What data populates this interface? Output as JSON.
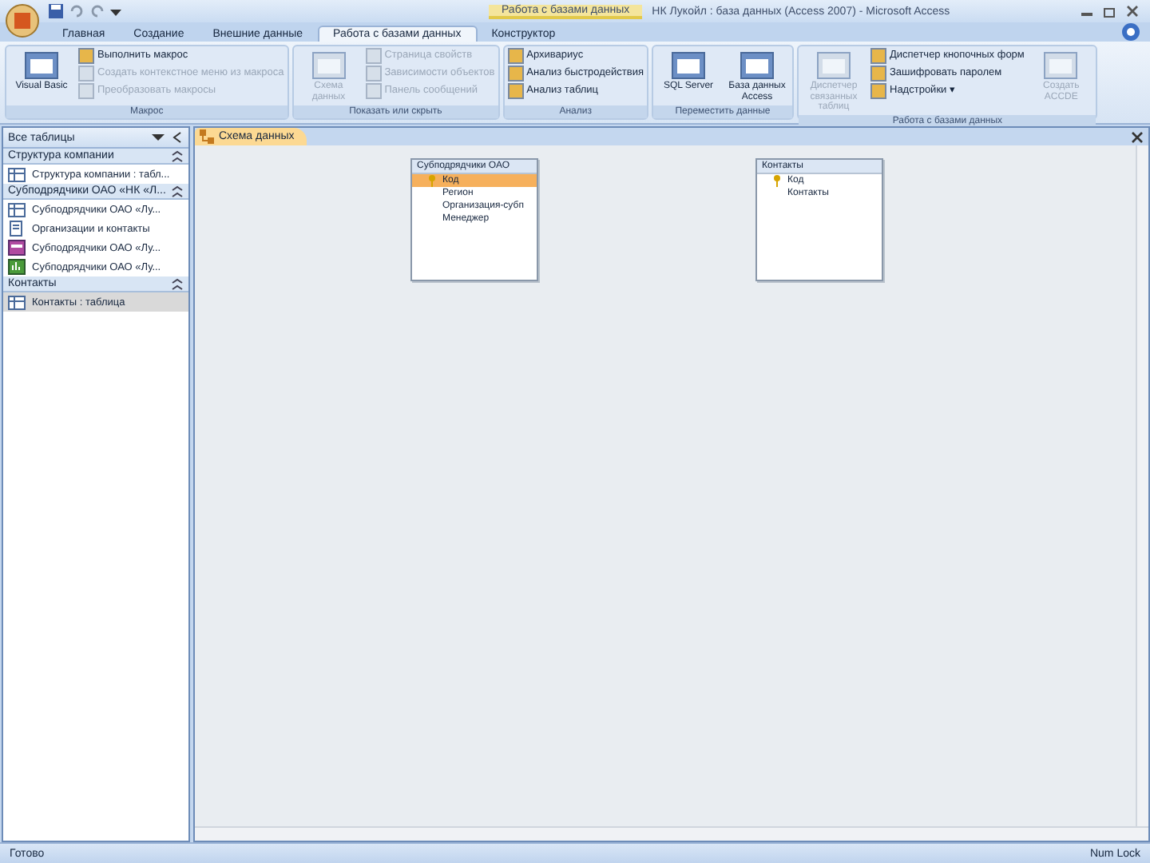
{
  "window": {
    "context_tab_title": "Работа с базами данных",
    "title": "НК Лукойл : база данных (Access 2007) - Microsoft Access"
  },
  "tabs": [
    {
      "label": "Главная",
      "selected": false
    },
    {
      "label": "Создание",
      "selected": false
    },
    {
      "label": "Внешние данные",
      "selected": false
    },
    {
      "label": "Работа с базами данных",
      "selected": true
    },
    {
      "label": "Конструктор",
      "selected": false
    }
  ],
  "ribbon_groups": [
    {
      "label": "Макрос",
      "large": [
        {
          "label": "Visual Basic",
          "disabled": false
        }
      ],
      "small": [
        {
          "label": "Выполнить макрос",
          "disabled": false
        },
        {
          "label": "Создать контекстное меню из макроса",
          "disabled": true
        },
        {
          "label": "Преобразовать макросы",
          "disabled": true
        }
      ]
    },
    {
      "label": "Показать или скрыть",
      "large": [
        {
          "label": "Схема данных",
          "disabled": true
        }
      ],
      "small": [
        {
          "label": "Страница свойств",
          "disabled": true
        },
        {
          "label": "Зависимости объектов",
          "disabled": true
        },
        {
          "label": "Панель сообщений",
          "disabled": true
        }
      ]
    },
    {
      "label": "Анализ",
      "small": [
        {
          "label": "Архивариус",
          "disabled": false
        },
        {
          "label": "Анализ быстродействия",
          "disabled": false
        },
        {
          "label": "Анализ таблиц",
          "disabled": false
        }
      ]
    },
    {
      "label": "Переместить данные",
      "large": [
        {
          "label": "SQL Server",
          "disabled": false
        },
        {
          "label": "База данных Access",
          "disabled": false
        }
      ]
    },
    {
      "label": "Работа с базами данных",
      "large": [
        {
          "label": "Диспетчер связанных таблиц",
          "disabled": true
        }
      ],
      "small": [
        {
          "label": "Диспетчер кнопочных форм",
          "disabled": false
        },
        {
          "label": "Зашифровать паролем",
          "disabled": false
        },
        {
          "label": "Надстройки ▾",
          "disabled": false
        }
      ],
      "large_after": [
        {
          "label": "Создать ACCDE",
          "disabled": true
        }
      ]
    }
  ],
  "navigation": {
    "title": "Все таблицы",
    "groups": [
      {
        "label": "Структура компании",
        "items": [
          {
            "label": "Структура компании : табл...",
            "kind": "table",
            "selected": false
          }
        ]
      },
      {
        "label": "Субподрядчики ОАО «НК «Л...",
        "items": [
          {
            "label": "Субподрядчики ОАО «Лу...",
            "kind": "table",
            "selected": false
          },
          {
            "label": "Организации и контакты",
            "kind": "query",
            "selected": false
          },
          {
            "label": "Субподрядчики ОАО «Лу...",
            "kind": "form",
            "selected": false
          },
          {
            "label": "Субподрядчики ОАО «Лу...",
            "kind": "report",
            "selected": false
          }
        ]
      },
      {
        "label": "Контакты",
        "items": [
          {
            "label": "Контакты : таблица",
            "kind": "table",
            "selected": true
          }
        ]
      }
    ]
  },
  "document_tab": "Схема данных",
  "tables": [
    {
      "title": "Субподрядчики ОАО",
      "fields": [
        {
          "label": "Код",
          "key": true,
          "selected": true
        },
        {
          "label": "Регион",
          "key": false,
          "selected": false
        },
        {
          "label": "Организация-субп",
          "key": false,
          "selected": false
        },
        {
          "label": "Менеджер",
          "key": false,
          "selected": false
        }
      ]
    },
    {
      "title": "Контакты",
      "fields": [
        {
          "label": "Код",
          "key": true,
          "selected": false
        },
        {
          "label": "Контакты",
          "key": false,
          "selected": false
        }
      ]
    }
  ],
  "status_bar": {
    "left": "Готово",
    "right": "Num Lock"
  }
}
